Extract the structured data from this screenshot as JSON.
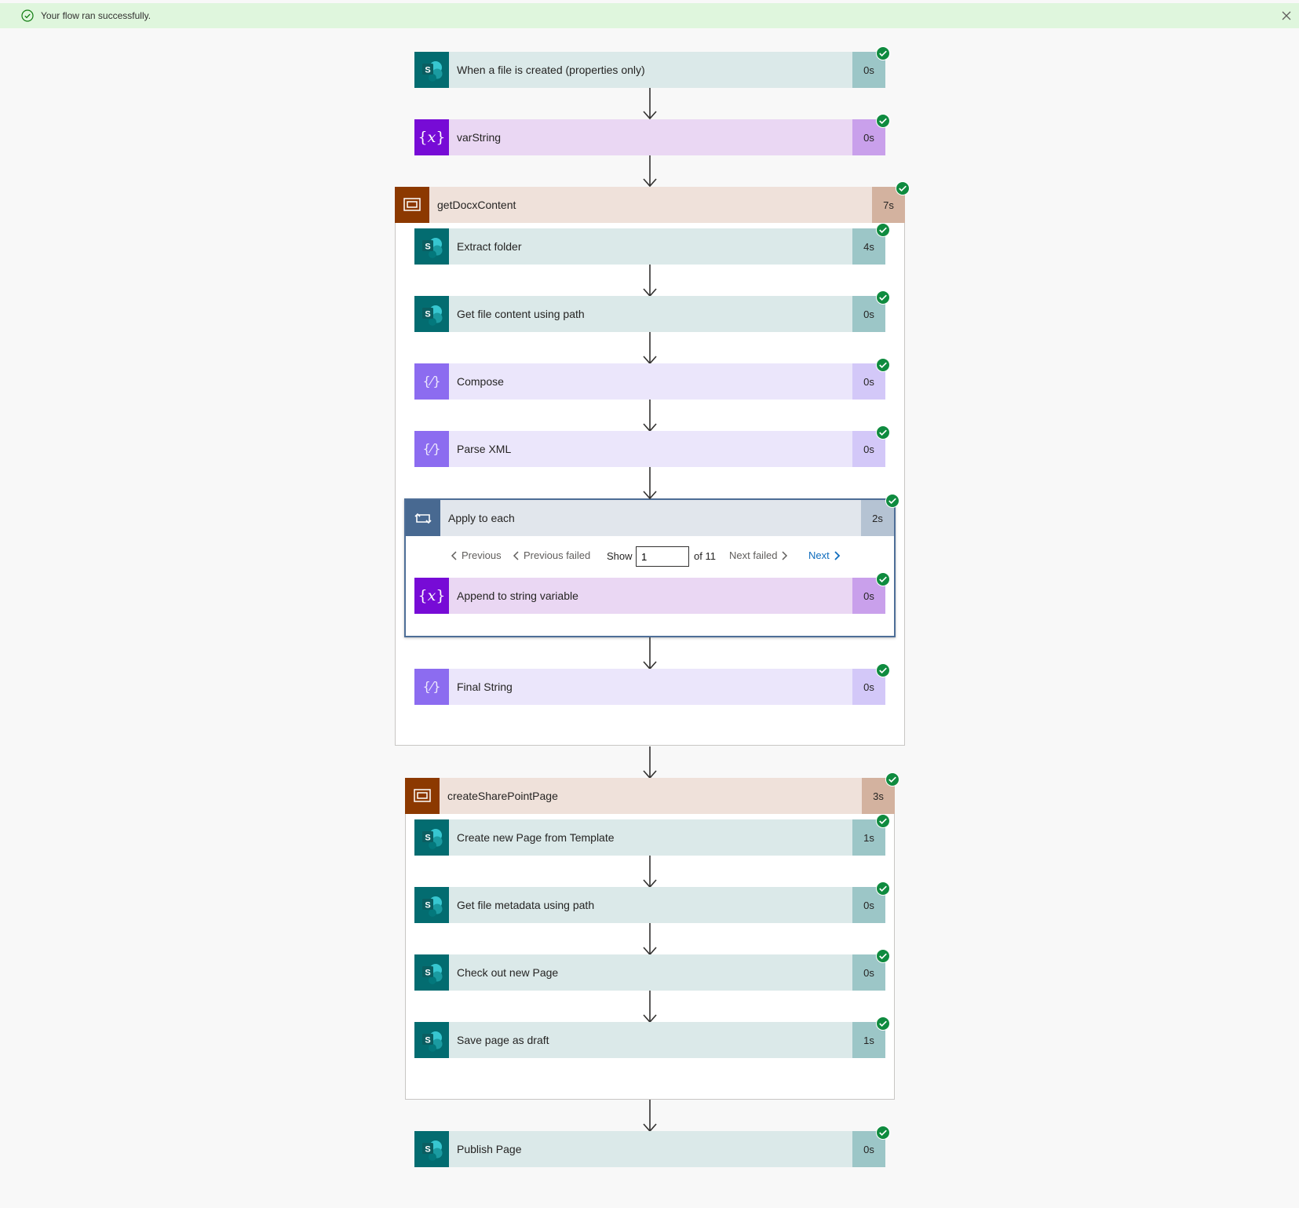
{
  "banner": {
    "message": "Your flow ran successfully."
  },
  "flow": {
    "trigger": {
      "title": "When a file is created (properties only)",
      "duration": "0s"
    },
    "var_string": {
      "title": "varString",
      "duration": "0s"
    },
    "scope1": {
      "title": "getDocxContent",
      "duration": "7s",
      "extract": {
        "title": "Extract folder",
        "duration": "4s"
      },
      "get_file": {
        "title": "Get file content using path",
        "duration": "0s"
      },
      "compose": {
        "title": "Compose",
        "duration": "0s"
      },
      "parse": {
        "title": "Parse XML",
        "duration": "0s"
      },
      "apply": {
        "title": "Apply to each",
        "duration": "2s",
        "pager": {
          "previous": "Previous",
          "previous_failed": "Previous failed",
          "show": "Show",
          "value": "1",
          "of": "of 11",
          "next_failed": "Next failed",
          "next": "Next"
        },
        "append": {
          "title": "Append to string variable",
          "duration": "0s"
        }
      },
      "final": {
        "title": "Final String",
        "duration": "0s"
      }
    },
    "scope2": {
      "title": "createSharePointPage",
      "duration": "3s",
      "create": {
        "title": "Create new Page from Template",
        "duration": "1s"
      },
      "metadata": {
        "title": "Get file metadata using path",
        "duration": "0s"
      },
      "checkout": {
        "title": "Check out new Page",
        "duration": "0s"
      },
      "save": {
        "title": "Save page as draft",
        "duration": "1s"
      }
    },
    "publish": {
      "title": "Publish Page",
      "duration": "0s"
    }
  },
  "colors": {
    "sharepoint": "#036c70",
    "variable": "#770bd6",
    "compose": "#8c6cf0",
    "scope": "#8c3900",
    "loop": "#486991",
    "success": "#0f8b3f",
    "banner": "#dff6dd"
  }
}
